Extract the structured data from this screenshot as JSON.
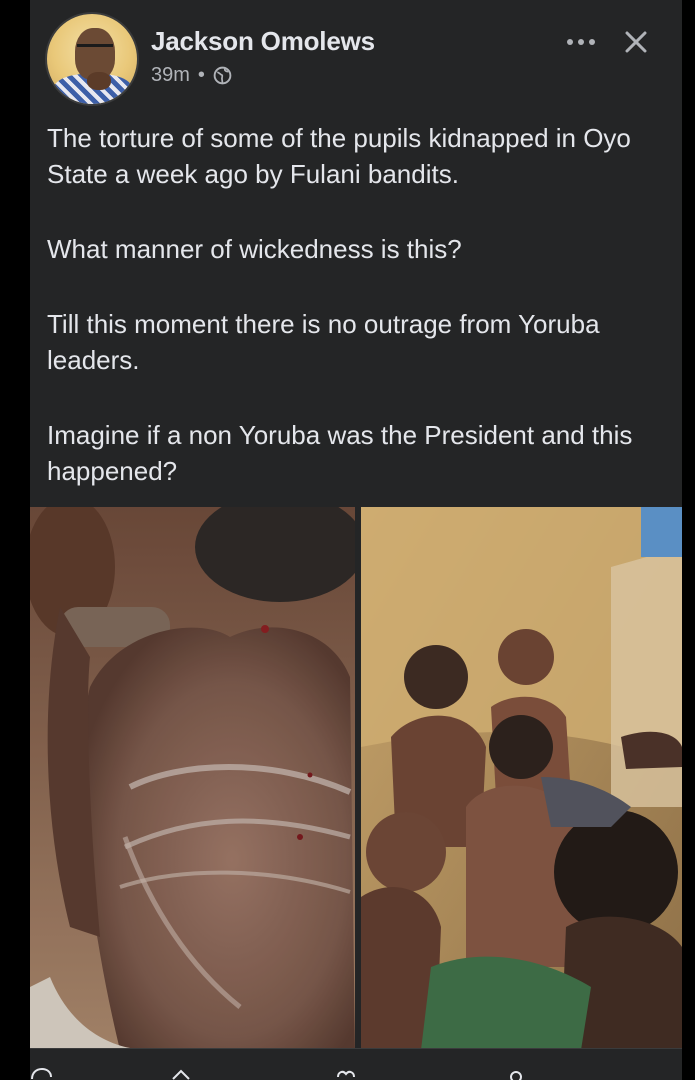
{
  "post": {
    "author_name": "Jackson Omolews",
    "timestamp": "39m",
    "separator": "•",
    "audience_icon": "globe-icon",
    "paragraphs": [
      "The torture of some of the pupils kidnapped in Oyo State a week ago by Fulani bandits.",
      "What manner of wickedness is this?",
      "Till this moment there is no outrage from Yoruba leaders.",
      "Imagine if a non Yoruba was the President and this happened?"
    ]
  },
  "header_actions": {
    "more_icon": "more-horizontal-icon",
    "close_icon": "close-icon"
  },
  "media": {
    "photo_count": 2
  },
  "action_bar": {
    "icons": [
      "comment-icon",
      "share-icon",
      "heart-icon",
      "person-icon"
    ]
  },
  "colors": {
    "background": "#000000",
    "card": "#242526",
    "text_primary": "#e4e6eb",
    "text_secondary": "#b0b3b8"
  }
}
